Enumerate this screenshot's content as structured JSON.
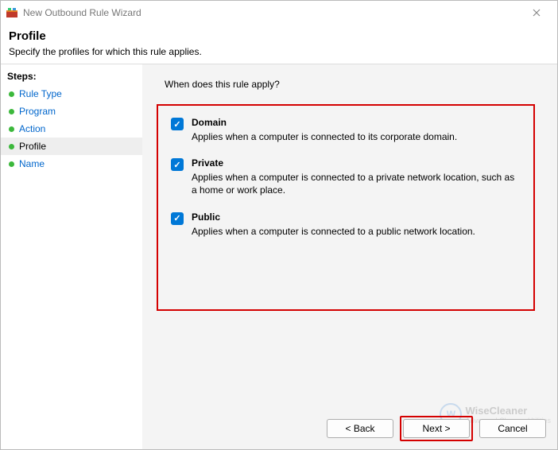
{
  "window": {
    "title": "New Outbound Rule Wizard"
  },
  "header": {
    "title": "Profile",
    "subtitle": "Specify the profiles for which this rule applies."
  },
  "sidebar": {
    "label": "Steps:",
    "items": [
      {
        "label": "Rule Type",
        "current": false
      },
      {
        "label": "Program",
        "current": false
      },
      {
        "label": "Action",
        "current": false
      },
      {
        "label": "Profile",
        "current": true
      },
      {
        "label": "Name",
        "current": false
      }
    ]
  },
  "content": {
    "prompt": "When does this rule apply?",
    "options": [
      {
        "title": "Domain",
        "checked": true,
        "desc": "Applies when a computer is connected to its corporate domain."
      },
      {
        "title": "Private",
        "checked": true,
        "desc": "Applies when a computer is connected to a private network location, such as a home or work place."
      },
      {
        "title": "Public",
        "checked": true,
        "desc": "Applies when a computer is connected to a public network location."
      }
    ]
  },
  "footer": {
    "back": "< Back",
    "next": "Next >",
    "cancel": "Cancel"
  },
  "watermark": {
    "brand": "WiseCleaner",
    "tag": "Advanced Cleanup Utilities",
    "logo_text": "W"
  }
}
